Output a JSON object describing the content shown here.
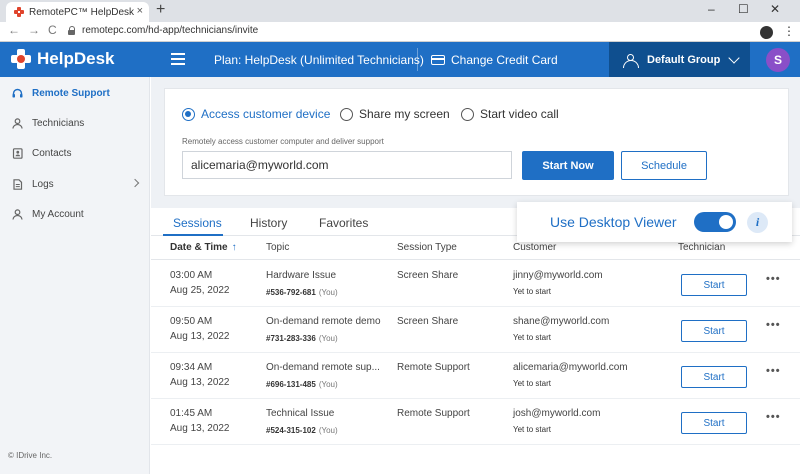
{
  "browser": {
    "tab_title": "RemotePC™ HelpDesk - Remote",
    "tab_close": "×",
    "new_tab": "+",
    "win_min": "–",
    "win_max": "☐",
    "win_close": "✕",
    "back": "←",
    "forward": "→",
    "reload": "C",
    "url": "remotepc.com/hd-app/technicians/invite",
    "menu": "⋮"
  },
  "header": {
    "logo_text": "HelpDesk",
    "plan": "Plan: HelpDesk (Unlimited Technicians)",
    "change_card": "Change Credit Card",
    "group": "Default Group",
    "avatar_letter": "S"
  },
  "sidebar": {
    "items": [
      {
        "label": "Remote Support"
      },
      {
        "label": "Technicians"
      },
      {
        "label": "Contacts"
      },
      {
        "label": "Logs"
      },
      {
        "label": "My Account"
      }
    ],
    "copyright": "© IDrive Inc."
  },
  "access": {
    "options": [
      "Access customer device",
      "Share my screen",
      "Start video call"
    ],
    "hint": "Remotely access customer computer and deliver support",
    "email_value": "alicemaria@myworld.com",
    "start_now": "Start Now",
    "schedule": "Schedule"
  },
  "tabs": [
    "Sessions",
    "History",
    "Favorites"
  ],
  "viewer": {
    "label": "Use Desktop Viewer",
    "info": "i"
  },
  "table": {
    "headers": [
      "Date & Time",
      "Topic",
      "Session Type",
      "Customer",
      "Technician"
    ],
    "sort_icon": "↑",
    "rows": [
      {
        "time": "03:00 AM",
        "date": "Aug 25, 2022",
        "topic": "Hardware Issue",
        "sid": "#536-792-681",
        "you": "(You)",
        "type": "Screen Share",
        "customer": "jinny@myworld.com",
        "status": "Yet to start",
        "action": "Start",
        "more": "•••"
      },
      {
        "time": "09:50 AM",
        "date": "Aug 13, 2022",
        "topic": "On-demand remote demo",
        "sid": "#731-283-336",
        "you": "(You)",
        "type": "Screen Share",
        "customer": "shane@myworld.com",
        "status": "Yet to start",
        "action": "Start",
        "more": "•••"
      },
      {
        "time": "09:34 AM",
        "date": "Aug 13, 2022",
        "topic": "On-demand remote sup...",
        "sid": "#696-131-485",
        "you": "(You)",
        "type": "Remote Support",
        "customer": "alicemaria@myworld.com",
        "status": "Yet to start",
        "action": "Start",
        "more": "•••"
      },
      {
        "time": "01:45 AM",
        "date": "Aug 13, 2022",
        "topic": "Technical Issue",
        "sid": "#524-315-102",
        "you": "(You)",
        "type": "Remote Support",
        "customer": "josh@myworld.com",
        "status": "Yet to start",
        "action": "Start",
        "more": "•••"
      }
    ]
  },
  "colors": {
    "brand": "#1f6fc5",
    "header_dark": "#0f4f8f",
    "avatar": "#8a4fc8",
    "logo_accent": "#e0442c"
  }
}
